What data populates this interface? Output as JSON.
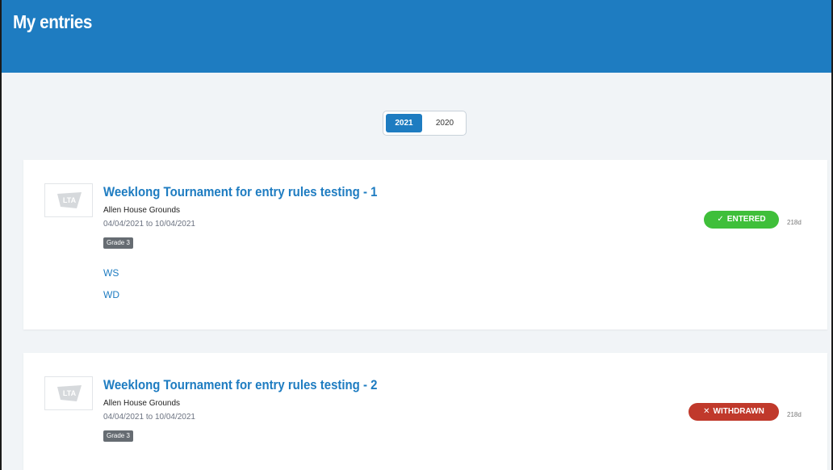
{
  "page": {
    "title": "My entries"
  },
  "years": [
    {
      "label": "2021",
      "active": true
    },
    {
      "label": "2020",
      "active": false
    }
  ],
  "logo_text": "LTA",
  "colors": {
    "brand_blue": "#1e7cc1",
    "entered_green": "#3fbf3a",
    "withdrawn_red": "#c0392b",
    "grade_gray": "#666c72"
  },
  "entries": [
    {
      "title": "Weeklong Tournament for entry rules testing - 1",
      "venue": "Allen House Grounds",
      "dates": "04/04/2021 to 10/04/2021",
      "grade": "Grade 3",
      "events": [
        "WS",
        "WD"
      ],
      "status": {
        "label": "ENTERED",
        "icon": "check-icon"
      },
      "age": "218d"
    },
    {
      "title": "Weeklong Tournament for entry rules testing - 2",
      "venue": "Allen House Grounds",
      "dates": "04/04/2021 to 10/04/2021",
      "grade": "Grade 3",
      "events": [],
      "status": {
        "label": "WITHDRAWN",
        "icon": "cross-icon"
      },
      "age": "218d"
    }
  ]
}
